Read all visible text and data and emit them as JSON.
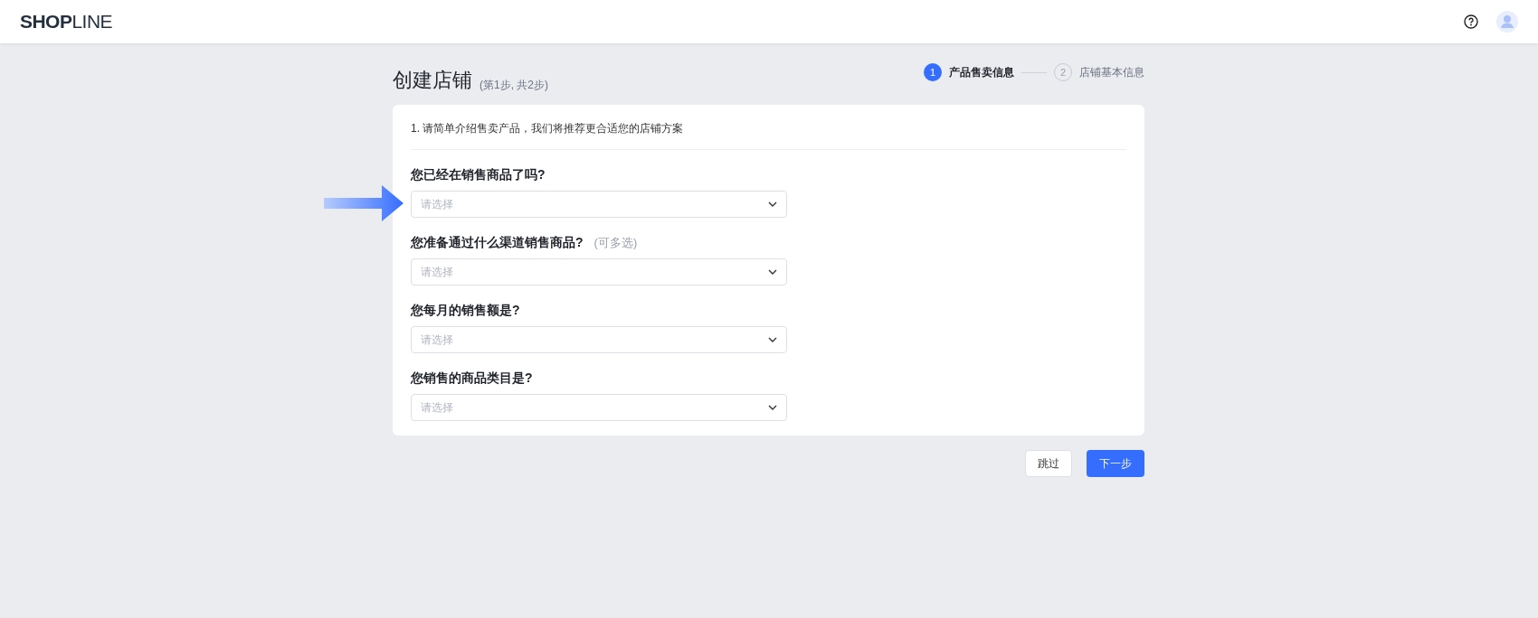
{
  "header": {
    "logo": "**SHOP**LINE"
  },
  "page": {
    "title": "创建店铺",
    "subtitle": "(第1步, 共2步)"
  },
  "steps": [
    {
      "number": "1",
      "label": "产品售卖信息",
      "selected": true
    },
    {
      "number": "2",
      "label": "店铺基本信息",
      "selected": false
    }
  ],
  "card": {
    "intro": "1. 请简单介绍售卖产品，我们将推荐更合适您的店铺方案",
    "questions": [
      {
        "label": "您已经在销售商品了吗?",
        "placeholder": "请选择",
        "highlighted": true
      },
      {
        "label": "您准备通过什么渠道销售商品?",
        "hint": "(可多选)",
        "placeholder": "请选择",
        "highlighted": false
      },
      {
        "label": "您每月的销售额是?",
        "placeholder": "请选择",
        "highlighted": false
      },
      {
        "label": "您销售的商品类目是?",
        "placeholder": "请选择",
        "highlighted": false
      }
    ]
  },
  "buttons": [
    {
      "label": "跳过",
      "kind": "secondary"
    },
    {
      "label": "下一步",
      "kind": "primary"
    }
  ]
}
